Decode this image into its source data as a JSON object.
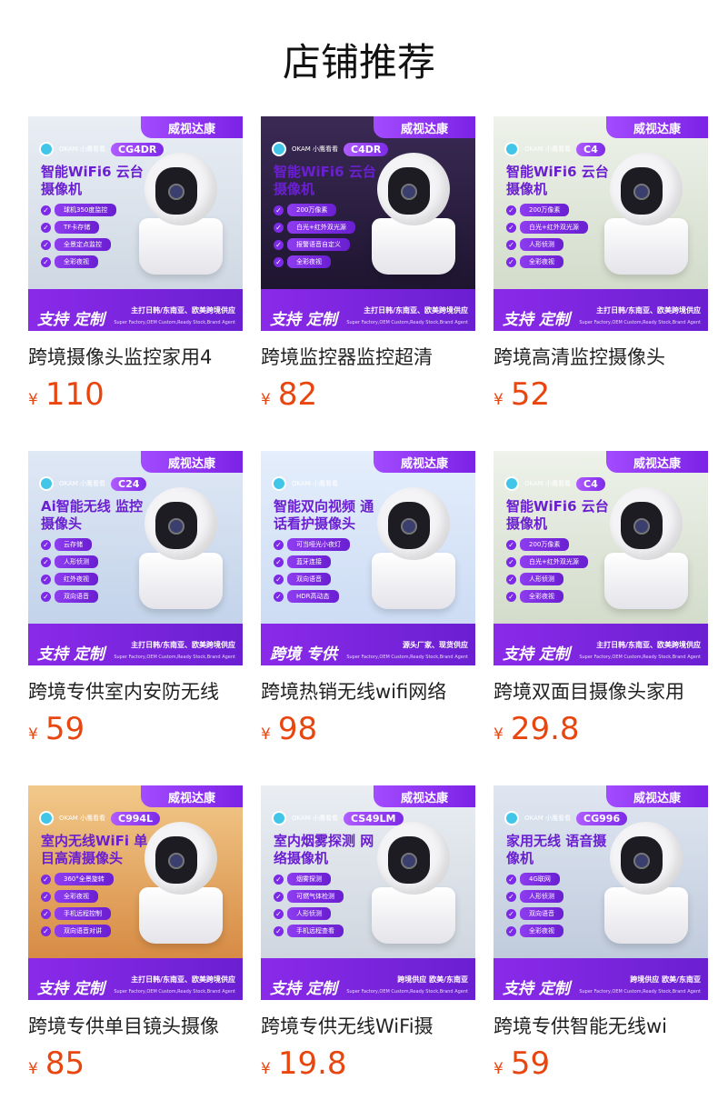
{
  "page": {
    "title": "店铺推荐"
  },
  "colors": {
    "price": "#e8460e",
    "brand_purple": "#7d2ae8"
  },
  "products": [
    {
      "brand": "威视达康",
      "logo": "OKAM 小鹰看看",
      "model": "CG4DR",
      "headline": "智能WiFi6 云台摄像机",
      "features": [
        "球机350度监控",
        "TF卡存储",
        "全景定点监控",
        "全彩夜视"
      ],
      "tag": "支持 定制",
      "bar_main": "主打日韩/东南亚、欧美跨境供应",
      "bar_sub": "Super Factory,OEM Custom,Ready Stock,Brand Agent",
      "title": "跨境摄像头监控家用4",
      "currency": "¥",
      "price": "110"
    },
    {
      "brand": "威视达康",
      "logo": "OKAM 小鹰看看",
      "model": "C4DR",
      "headline": "智能WiFi6 云台摄像机",
      "features": [
        "200万像素",
        "白光+红外双光源",
        "报警语音自定义",
        "全彩夜视"
      ],
      "tag": "支持 定制",
      "bar_main": "主打日韩/东南亚、欧美跨境供应",
      "bar_sub": "Super Factory,OEM Custom,Ready Stock,Brand Agent",
      "title": "跨境监控器监控超清",
      "currency": "¥",
      "price": "82"
    },
    {
      "brand": "威视达康",
      "logo": "OKAM 小鹰看看",
      "model": "C4",
      "headline": "智能WiFi6 云台摄像机",
      "features": [
        "200万像素",
        "白光+红外双光源",
        "人形侦测",
        "全彩夜视"
      ],
      "tag": "支持 定制",
      "bar_main": "主打日韩/东南亚、欧美跨境供应",
      "bar_sub": "Super Factory,OEM Custom,Ready Stock,Brand Agent",
      "title": "跨境高清监控摄像头",
      "currency": "¥",
      "price": "52"
    },
    {
      "brand": "威视达康",
      "logo": "OKAM 小鹰看看",
      "model": "C24",
      "headline": "Ai智能无线 监控摄像头",
      "features": [
        "云存储",
        "人形侦测",
        "红外夜视",
        "双向语音"
      ],
      "tag": "支持 定制",
      "bar_main": "主打日韩/东南亚、欧美跨境供应",
      "bar_sub": "Super Factory,OEM Custom,Ready Stock,Brand Agent",
      "title": "跨境专供室内安防无线",
      "currency": "¥",
      "price": "59"
    },
    {
      "brand": "威视达康",
      "logo": "OKAM 小鹰看看",
      "model": "",
      "headline": "智能双向视频 通话看护摄像头",
      "features": [
        "可当哑光小夜灯",
        "蓝牙连接",
        "双向语音",
        "HDR高动态"
      ],
      "tag": "跨境 专供",
      "bar_main": "源头厂家、现货供应",
      "bar_sub": "Super Factory,OEM Custom,Ready Stock,Brand Agent",
      "title": "跨境热销无线wifi网络",
      "currency": "¥",
      "price": "98"
    },
    {
      "brand": "威视达康",
      "logo": "OKAM 小鹰看看",
      "model": "C4",
      "headline": "智能WiFi6 云台摄像机",
      "features": [
        "200万像素",
        "白光+红外双光源",
        "人形侦测",
        "全彩夜视"
      ],
      "tag": "支持 定制",
      "bar_main": "主打日韩/东南亚、欧美跨境供应",
      "bar_sub": "Super Factory,OEM Custom,Ready Stock,Brand Agent",
      "title": "跨境双面目摄像头家用",
      "currency": "¥",
      "price": "29.8"
    },
    {
      "brand": "威视达康",
      "logo": "OKAM 小鹰看看",
      "model": "C994L",
      "headline": "室内无线WiFi 单目高清摄像头",
      "features": [
        "360°全景旋转",
        "全彩夜视",
        "手机远程控制",
        "双向语音对讲"
      ],
      "tag": "支持 定制",
      "bar_main": "主打日韩/东南亚、欧美跨境供应",
      "bar_sub": "Super Factory,OEM Custom,Ready Stock,Brand Agent",
      "title": "跨境专供单目镜头摄像",
      "currency": "¥",
      "price": "85"
    },
    {
      "brand": "威视达康",
      "logo": "OKAM 小鹰看看",
      "model": "CS49LM",
      "headline": "室内烟雾探测 网络摄像机",
      "features": [
        "烟雾探测",
        "可燃气体检测",
        "人形侦测",
        "手机远程查看"
      ],
      "tag": "支持 定制",
      "bar_main": "跨境供应 欧美/东南亚",
      "bar_sub": "Super Factory,OEM Custom,Ready Stock,Brand Agent",
      "title": "跨境专供无线WiFi摄",
      "currency": "¥",
      "price": "19.8"
    },
    {
      "brand": "威视达康",
      "logo": "OKAM 小鹰看看",
      "model": "CG996",
      "headline": "家用无线 语音摄像机",
      "features": [
        "4G联网",
        "人形侦测",
        "双向语音",
        "全彩夜视"
      ],
      "tag": "支持 定制",
      "bar_main": "跨境供应 欧美/东南亚",
      "bar_sub": "Super Factory,OEM Custom,Ready Stock,Brand Agent",
      "title": "跨境专供智能无线wi",
      "currency": "¥",
      "price": "59"
    }
  ]
}
